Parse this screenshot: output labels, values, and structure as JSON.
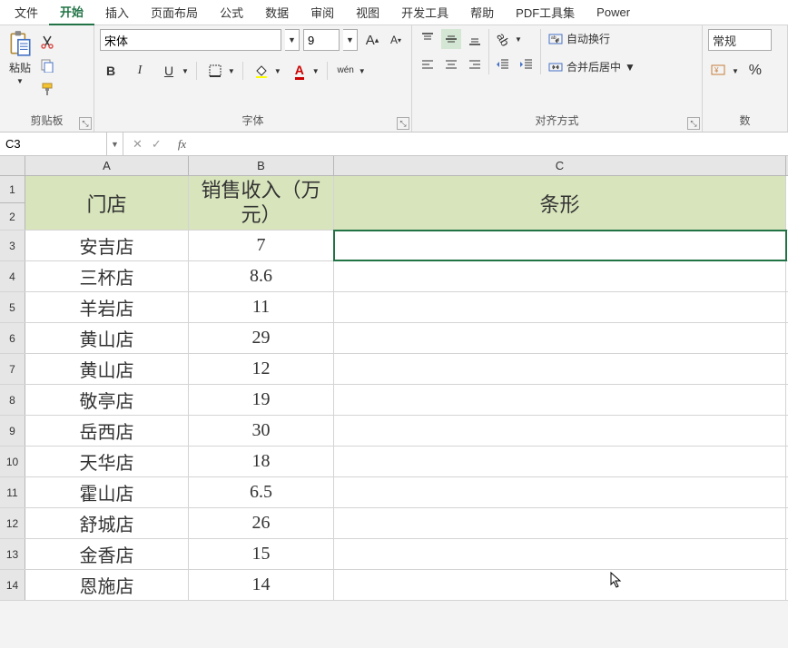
{
  "menu": {
    "items": [
      "文件",
      "开始",
      "插入",
      "页面布局",
      "公式",
      "数据",
      "审阅",
      "视图",
      "开发工具",
      "帮助",
      "PDF工具集",
      "Power"
    ],
    "active_index": 1
  },
  "ribbon": {
    "clipboard": {
      "paste": "粘贴",
      "group_label": "剪贴板"
    },
    "font": {
      "name": "宋体",
      "size": "9",
      "bold": "B",
      "italic": "I",
      "underline": "U",
      "wen": "wén",
      "group_label": "字体"
    },
    "align": {
      "wrap": "自动换行",
      "merge": "合并后居中",
      "group_label": "对齐方式"
    },
    "number": {
      "format": "常规",
      "group_label": "数"
    }
  },
  "formula_bar": {
    "name_box": "C3",
    "fx": "fx",
    "value": ""
  },
  "grid": {
    "columns": [
      "A",
      "B",
      "C"
    ],
    "header": {
      "A": "门店",
      "B": "销售收入（万元）",
      "C": "条形"
    },
    "rows": [
      {
        "n": 3,
        "A": "安吉店",
        "B": "7"
      },
      {
        "n": 4,
        "A": "三杯店",
        "B": "8.6"
      },
      {
        "n": 5,
        "A": "羊岩店",
        "B": "11"
      },
      {
        "n": 6,
        "A": "黄山店",
        "B": "29"
      },
      {
        "n": 7,
        "A": "黄山店",
        "B": "12"
      },
      {
        "n": 8,
        "A": "敬亭店",
        "B": "19"
      },
      {
        "n": 9,
        "A": "岳西店",
        "B": "30"
      },
      {
        "n": 10,
        "A": "天华店",
        "B": "18"
      },
      {
        "n": 11,
        "A": "霍山店",
        "B": "6.5"
      },
      {
        "n": 12,
        "A": "舒城店",
        "B": "26"
      },
      {
        "n": 13,
        "A": "金香店",
        "B": "15"
      },
      {
        "n": 14,
        "A": "恩施店",
        "B": "14"
      }
    ],
    "selected_cell": "C3"
  },
  "chart_data": {
    "type": "table",
    "title": "销售收入（万元）",
    "columns": [
      "门店",
      "销售收入（万元）",
      "条形"
    ],
    "rows": [
      [
        "安吉店",
        7,
        null
      ],
      [
        "三杯店",
        8.6,
        null
      ],
      [
        "羊岩店",
        11,
        null
      ],
      [
        "黄山店",
        29,
        null
      ],
      [
        "黄山店",
        12,
        null
      ],
      [
        "敬亭店",
        19,
        null
      ],
      [
        "岳西店",
        30,
        null
      ],
      [
        "天华店",
        18,
        null
      ],
      [
        "霍山店",
        6.5,
        null
      ],
      [
        "舒城店",
        26,
        null
      ],
      [
        "金香店",
        15,
        null
      ],
      [
        "恩施店",
        14,
        null
      ]
    ]
  }
}
